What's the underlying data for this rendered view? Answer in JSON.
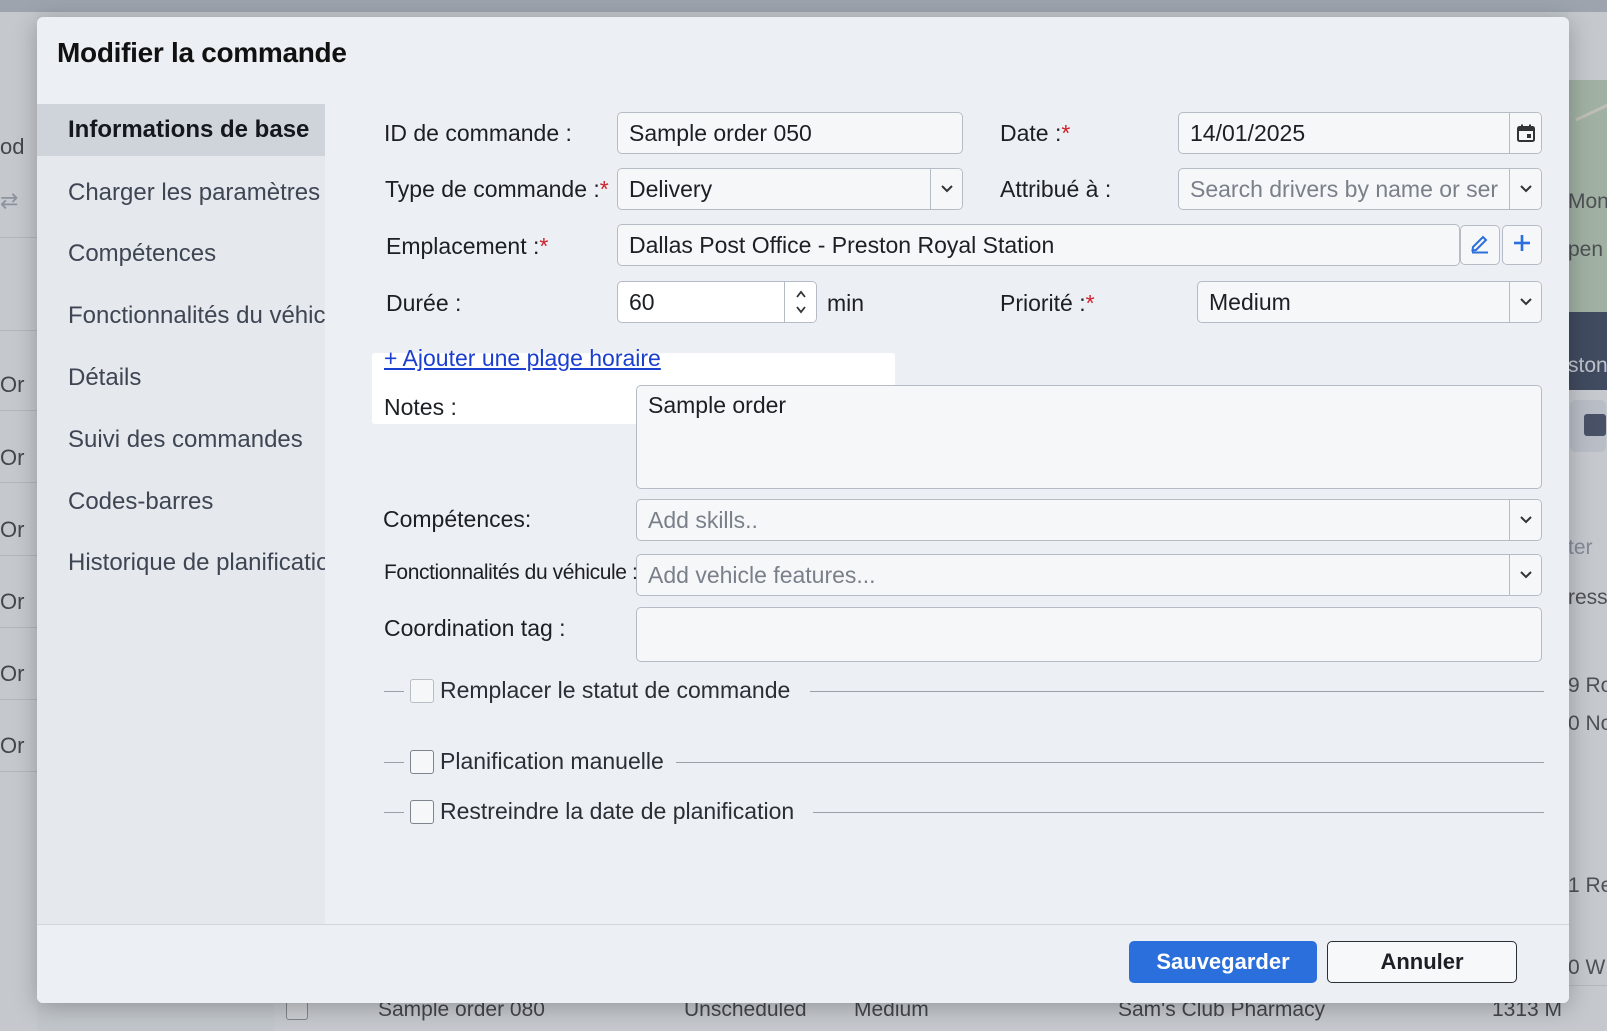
{
  "background": {
    "left_fragments": [
      "od",
      "Or",
      "Or",
      "Or",
      "Or",
      "Or",
      "Or"
    ],
    "right_fragments": [
      "Mont",
      "pen",
      "ston",
      "ter",
      "ress",
      "9 Ro",
      "0 No",
      "1 Re",
      "0 W"
    ],
    "bottom_row": [
      "Sample order 080",
      "Unscheduled",
      "Medium",
      "Sam's Club Pharmacy",
      "1313 M"
    ]
  },
  "modal": {
    "title": "Modifier la commande",
    "sidebar": [
      {
        "label": "Informations de base",
        "active": true
      },
      {
        "label": "Charger les paramètres",
        "active": false
      },
      {
        "label": "Compétences",
        "active": false
      },
      {
        "label": "Fonctionnalités du véhicule",
        "active": false
      },
      {
        "label": "Détails",
        "active": false
      },
      {
        "label": "Suivi des commandes",
        "active": false
      },
      {
        "label": "Codes-barres",
        "active": false
      },
      {
        "label": "Historique de planification",
        "active": false
      }
    ],
    "form": {
      "order_id": {
        "label": "ID de commande :",
        "value": "Sample order 050"
      },
      "date": {
        "label": "Date :",
        "required_mark": "*",
        "value": "14/01/2025"
      },
      "order_type": {
        "label": "Type de commande :",
        "required_mark": "*",
        "value": "Delivery"
      },
      "assigned_to": {
        "label": "Attribué à :",
        "placeholder": "Search drivers by name or ser"
      },
      "location": {
        "label": "Emplacement :",
        "required_mark": "*",
        "value": "Dallas Post Office - Preston Royal Station"
      },
      "duration": {
        "label": "Durée :",
        "value": "60",
        "unit": "min"
      },
      "priority": {
        "label": "Priorité :",
        "required_mark": "*",
        "value": "Medium"
      },
      "add_time_window": "+ Ajouter une plage horaire",
      "notes": {
        "label": "Notes :",
        "value": "Sample order"
      },
      "skills": {
        "label": "Compétences:",
        "placeholder": "Add skills.."
      },
      "vehicle_features": {
        "label": "Fonctionnalités du véhicule :",
        "placeholder": "Add vehicle features..."
      },
      "coordination_tag": {
        "label": "Coordination tag :",
        "value": ""
      },
      "override_status": {
        "label": "Remplacer le statut de commande",
        "checked": false
      },
      "manual_scheduling": {
        "label": "Planification manuelle",
        "checked": false
      },
      "restrict_date": {
        "label": "Restreindre la date de planification",
        "checked": false
      }
    },
    "footer": {
      "save_label": "Sauvegarder",
      "cancel_label": "Annuler"
    }
  },
  "colors": {
    "accent": "#2a6fdb",
    "required": "#d0202a",
    "link": "#1a3fd0"
  }
}
